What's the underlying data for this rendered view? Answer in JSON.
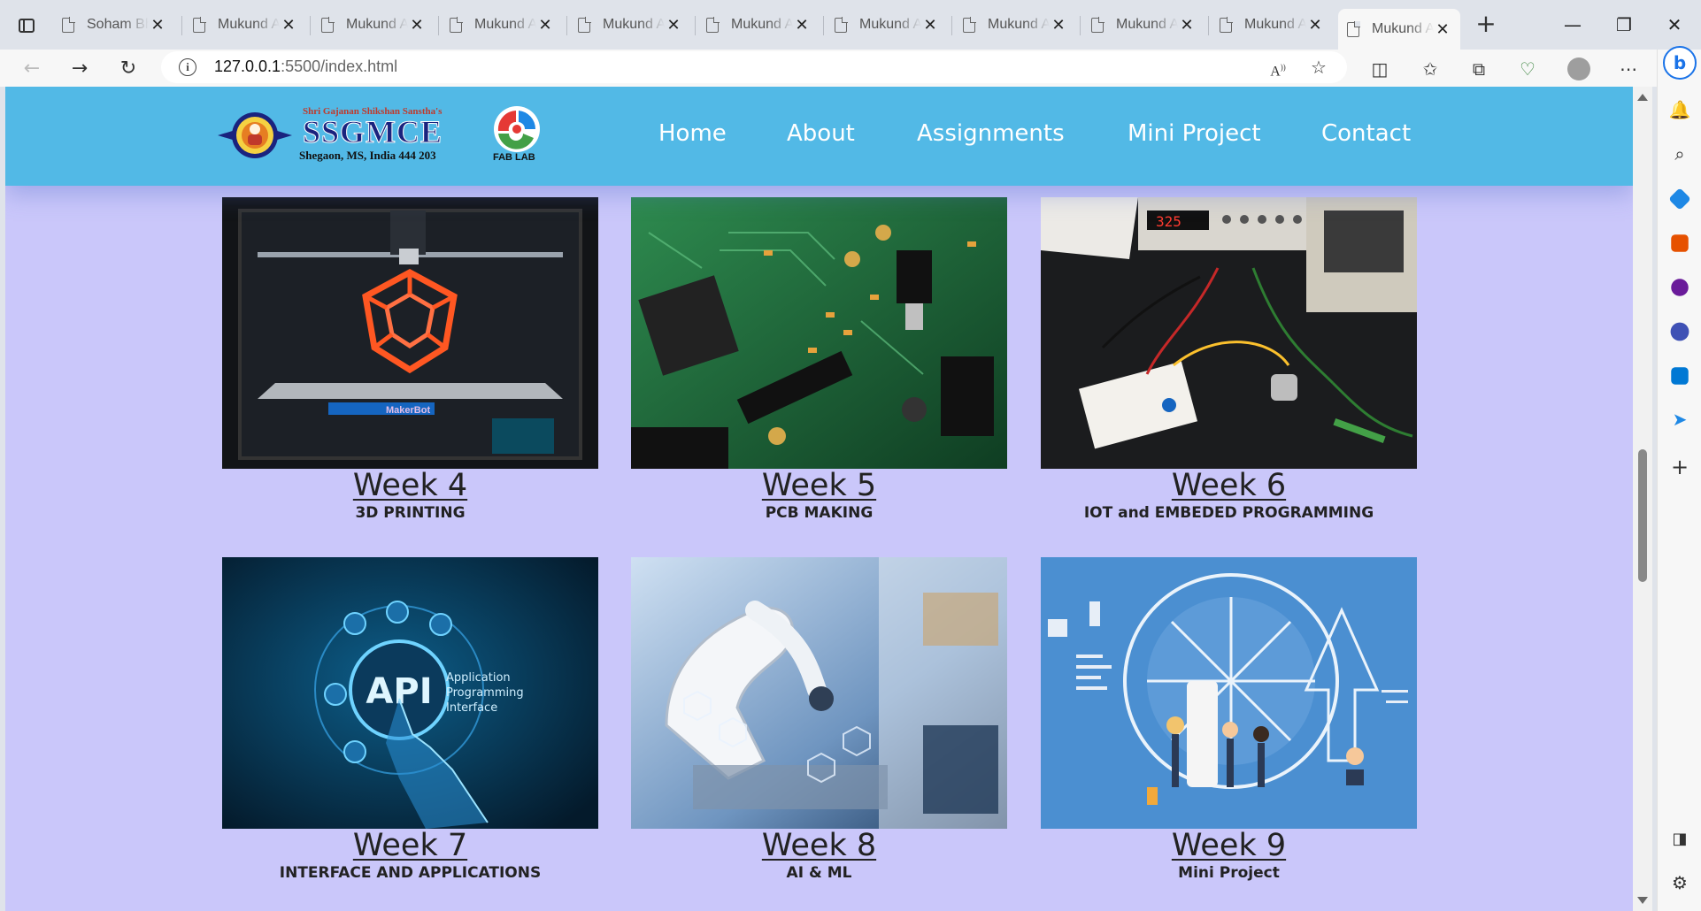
{
  "browser": {
    "tabs": [
      {
        "title": "Soham Bhagat"
      },
      {
        "title": "Mukund Assignment"
      },
      {
        "title": "Mukund Assignment"
      },
      {
        "title": "Mukund Assignment"
      },
      {
        "title": "Mukund Assignment"
      },
      {
        "title": "Mukund Assignment"
      },
      {
        "title": "Mukund Assignment"
      },
      {
        "title": "Mukund Assignment"
      },
      {
        "title": "Mukund Assignment"
      },
      {
        "title": "Mukund Assignment"
      },
      {
        "title": "Mukund Assignment"
      }
    ],
    "url_host": "127.0.0.1",
    "url_rest": ":5500/index.html"
  },
  "site": {
    "logo": {
      "tagline": "Shri Gajanan Shikshan Sanstha's",
      "name": "SSGMCE",
      "address": "Shegaon, MS, India 444 203"
    },
    "fablab_label": "FAB LAB",
    "nav": [
      "Home",
      "About",
      "Assignments",
      "Mini Project",
      "Contact"
    ]
  },
  "cards": [
    {
      "title": "Week 4",
      "subtitle": "3D PRINTING",
      "image": "3d-printer-photo",
      "brand_text": "MakerBot"
    },
    {
      "title": "Week 5",
      "subtitle": "PCB MAKING",
      "image": "pcb-photo"
    },
    {
      "title": "Week 6",
      "subtitle": "IOT and EMBEDED PROGRAMMING",
      "image": "breadboard-photo",
      "meter": "325"
    },
    {
      "title": "Week 7",
      "subtitle": "INTERFACE AND APPLICATIONS",
      "image": "api-illustration",
      "api": "API",
      "api_caption_1": "Application",
      "api_caption_2": "Programming",
      "api_caption_3": "Interface"
    },
    {
      "title": "Week 8",
      "subtitle": "AI & ML",
      "image": "robot-arm-photo"
    },
    {
      "title": "Week 9",
      "subtitle": "Mini Project",
      "image": "project-illustration"
    }
  ],
  "colors": {
    "page_bg": "#cac7fa",
    "header_bg": "#52b9e6",
    "nav_text": "#ffffff",
    "card_text": "#222222"
  }
}
